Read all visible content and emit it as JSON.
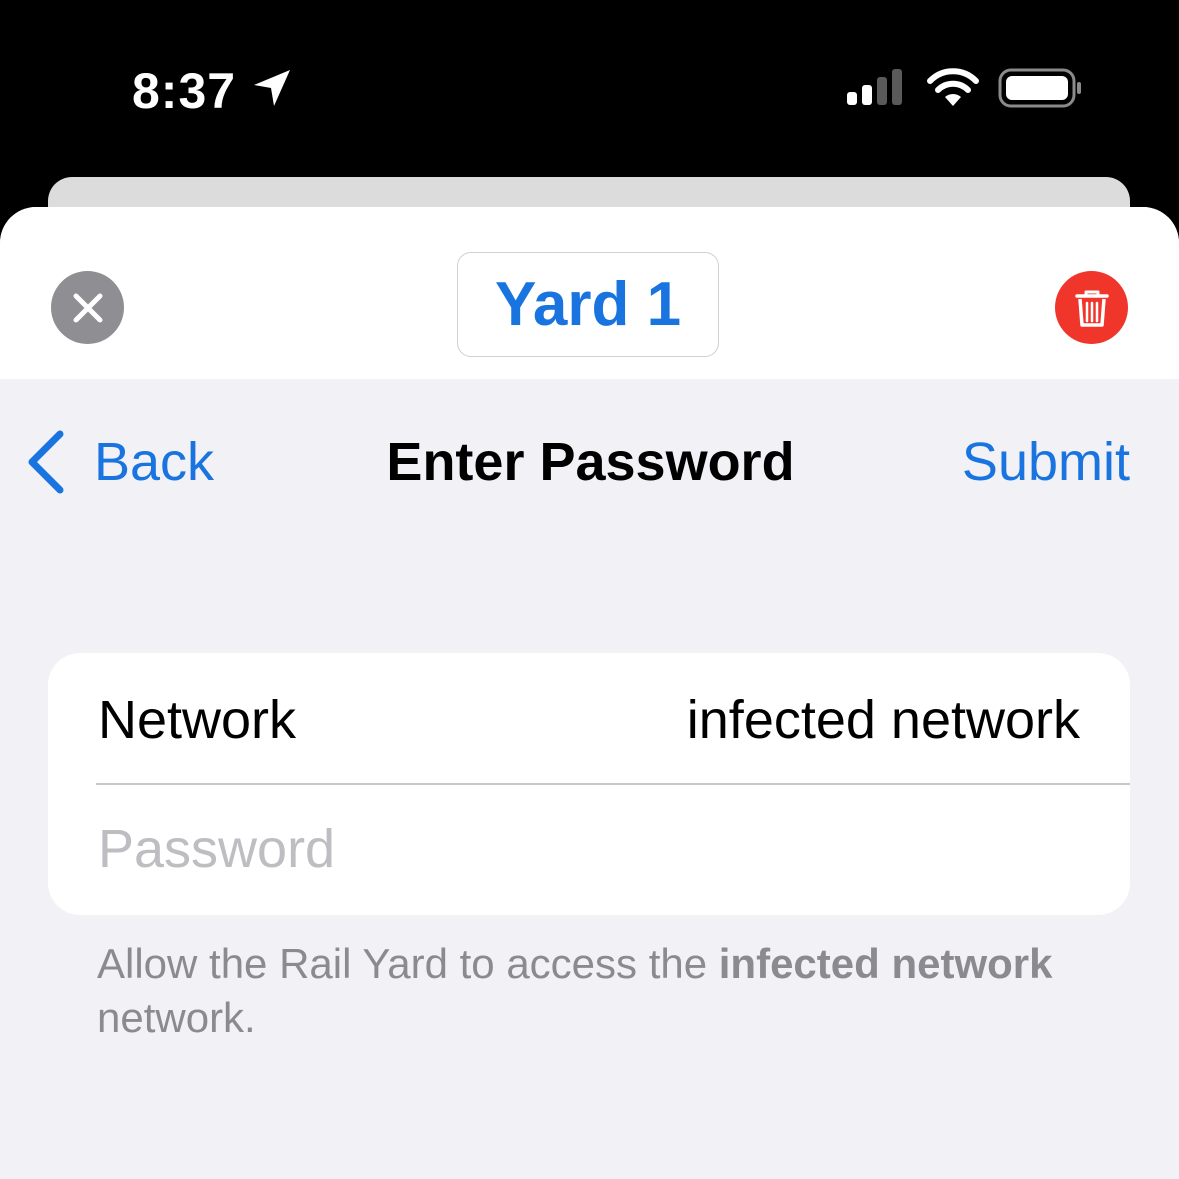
{
  "status_bar": {
    "time": "8:37"
  },
  "header": {
    "title": "Yard 1"
  },
  "nav": {
    "back_label": "Back",
    "title": "Enter Password",
    "submit_label": "Submit"
  },
  "form": {
    "network_label": "Network",
    "network_value": "infected network",
    "password_placeholder": "Password",
    "password_value": ""
  },
  "footer": {
    "text_before": "Allow the Rail Yard to access the ",
    "network_name": "infected network",
    "text_after": " network."
  },
  "colors": {
    "accent": "#1a74e0",
    "destructive": "#f0352a",
    "background": "#f1f1f6"
  }
}
